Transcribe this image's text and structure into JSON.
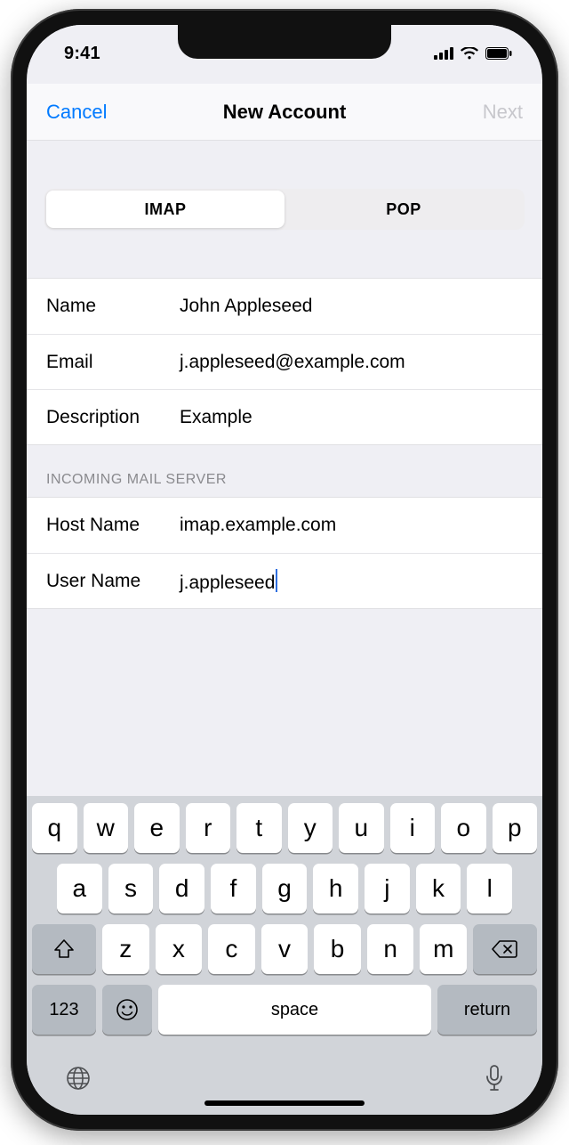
{
  "statusbar": {
    "time": "9:41"
  },
  "navbar": {
    "cancel": "Cancel",
    "title": "New Account",
    "next": "Next"
  },
  "segmented": {
    "imap": "IMAP",
    "pop": "POP"
  },
  "account": {
    "name_label": "Name",
    "name_value": "John Appleseed",
    "email_label": "Email",
    "email_value": "j.appleseed@example.com",
    "desc_label": "Description",
    "desc_value": "Example"
  },
  "incoming": {
    "header": "INCOMING MAIL SERVER",
    "host_label": "Host Name",
    "host_value": "imap.example.com",
    "user_label": "User Name",
    "user_value": "j.appleseed"
  },
  "keyboard": {
    "row1": [
      "q",
      "w",
      "e",
      "r",
      "t",
      "y",
      "u",
      "i",
      "o",
      "p"
    ],
    "row2": [
      "a",
      "s",
      "d",
      "f",
      "g",
      "h",
      "j",
      "k",
      "l"
    ],
    "row3": [
      "z",
      "x",
      "c",
      "v",
      "b",
      "n",
      "m"
    ],
    "num": "123",
    "space": "space",
    "return": "return"
  }
}
